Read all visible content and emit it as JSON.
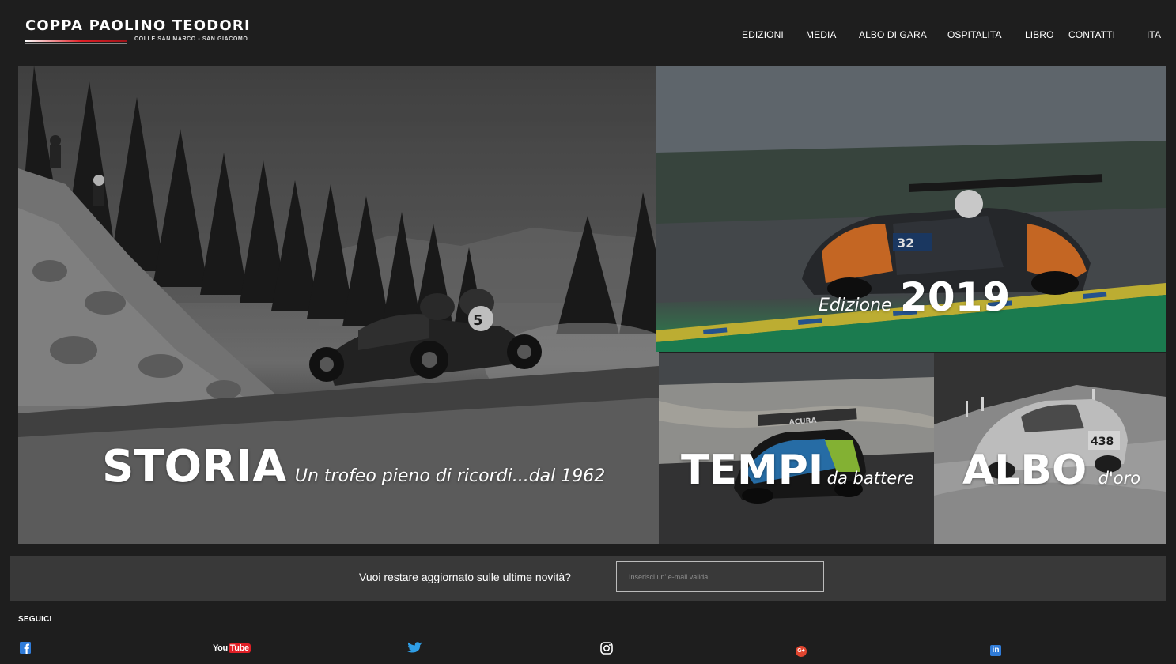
{
  "header": {
    "logo_title": "COPPA PAOLINO TEODORI",
    "logo_subtitle": "COLLE SAN MARCO - SAN GIACOMO"
  },
  "nav": {
    "items": [
      {
        "label": "EDIZIONI"
      },
      {
        "label": "MEDIA"
      },
      {
        "label": "ALBO DI GARA"
      },
      {
        "label": "OSPITALITA"
      },
      {
        "label": "LIBRO"
      },
      {
        "label": "CONTATTI"
      },
      {
        "label": "ITA"
      }
    ]
  },
  "tiles": {
    "storia": {
      "title": "STORIA",
      "subtitle": "Un trofeo pieno di ricordi...dal 1962"
    },
    "edizione": {
      "prefix": "Edizione",
      "year": "2019",
      "car_number": "32"
    },
    "tempi": {
      "title": "TEMPI",
      "subtitle": "da battere",
      "wing_text": "ACURA"
    },
    "albo": {
      "title": "ALBO",
      "subtitle": "d'oro",
      "car_number": "438"
    }
  },
  "newsletter": {
    "label": "Vuoi restare aggiornato sulle ultime novità?",
    "placeholder": "Inserisci un' e-mail valida"
  },
  "footer": {
    "follow_label": "SEGUICI",
    "social": [
      {
        "icon": "facebook-icon"
      },
      {
        "icon": "youtube-icon",
        "text": "You",
        "text2": "Tube"
      },
      {
        "icon": "twitter-icon"
      },
      {
        "icon": "instagram-icon"
      },
      {
        "icon": "google-plus-icon",
        "text": "G+"
      },
      {
        "icon": "linkedin-icon",
        "text": "in"
      }
    ]
  },
  "colors": {
    "accent_red": "#e11f26",
    "background": "#1e1e1e",
    "newsletter_bar": "#393939",
    "social_blue": "#2f7bd8"
  }
}
